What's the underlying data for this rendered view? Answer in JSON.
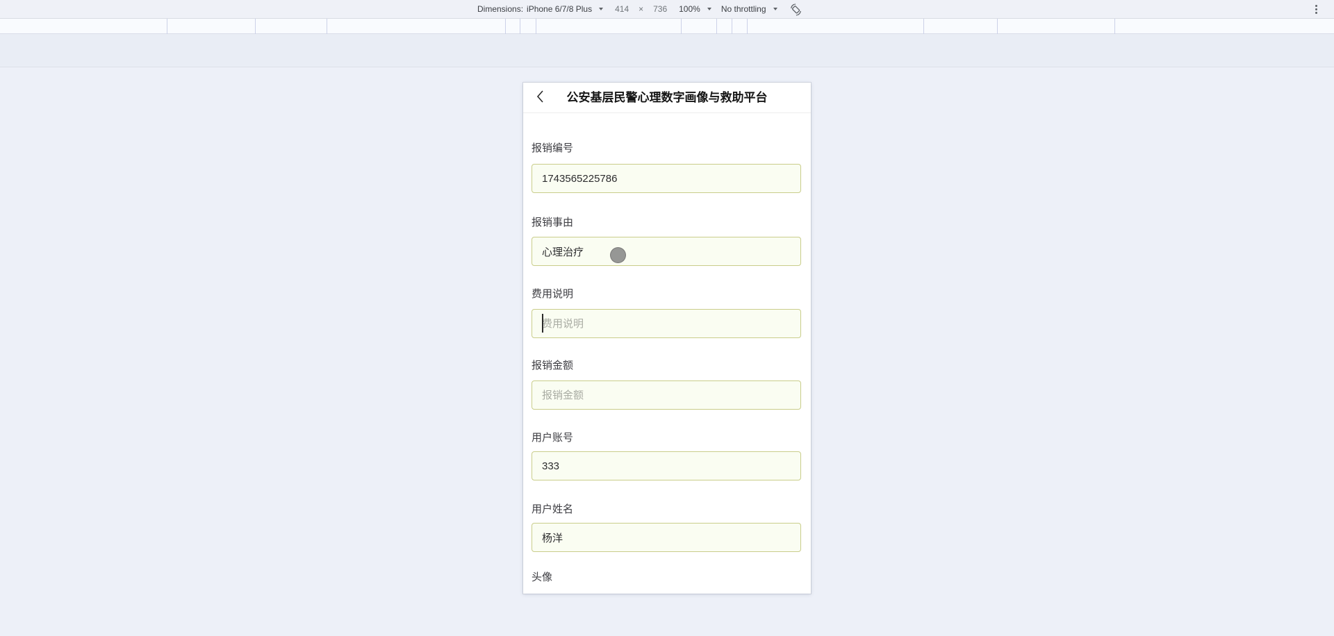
{
  "device_toolbar": {
    "dimensions_label": "Dimensions:",
    "device_select": "iPhone 6/7/8 Plus",
    "width_value": "414",
    "multiply_sign": "×",
    "height_value": "736",
    "zoom_select": "100%",
    "throttling_select": "No throttling",
    "rotate_icon_name": "screen-rotation-icon",
    "menu_icon_name": "vertical-dots-icon"
  },
  "app": {
    "header": {
      "back_icon_name": "chevron-left-icon",
      "title": "公安基层民警心理数字画像与救助平台"
    },
    "form": {
      "fields": [
        {
          "label": "报销编号",
          "value": "1743565225786",
          "placeholder": ""
        },
        {
          "label": "报销事由",
          "value": "心理治疗",
          "placeholder": ""
        },
        {
          "label": "费用说明",
          "value": "",
          "placeholder": "费用说明"
        },
        {
          "label": "报销金额",
          "value": "",
          "placeholder": "报销金额"
        },
        {
          "label": "用户账号",
          "value": "333",
          "placeholder": ""
        },
        {
          "label": "用户姓名",
          "value": "杨洋",
          "placeholder": ""
        }
      ],
      "avatar_label": "头像"
    }
  },
  "cursor": {
    "type": "touch-circle-cursor"
  },
  "colors": {
    "page_background": "#edf0f8",
    "toolbar_background": "#eff1f7",
    "input_border": "#c9cd8a",
    "input_background": "#fafdf2",
    "placeholder_text": "#a9aca3"
  }
}
